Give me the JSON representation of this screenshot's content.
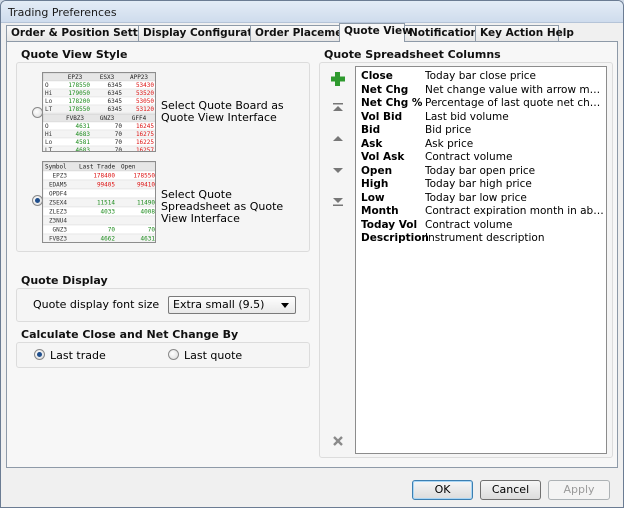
{
  "window": {
    "title": "Trading Preferences"
  },
  "tabs": [
    {
      "label": "Order & Position Settings"
    },
    {
      "label": "Display Configuration"
    },
    {
      "label": "Order Placement"
    },
    {
      "label": "Quote View"
    },
    {
      "label": "Notifications"
    },
    {
      "label": "Key Action Help"
    }
  ],
  "quote_view_style": {
    "title": "Quote View Style",
    "board_option": "Select Quote Board as Quote View Interface",
    "spreadsheet_option": "Select Quote Spreadsheet as Quote View Interface",
    "selected": "spreadsheet",
    "board_preview": {
      "top_headers": [
        "EPZ3",
        "ESX3",
        "APP23"
      ],
      "top_rows": [
        {
          "label": "O",
          "v": [
            "178550",
            "6345",
            "53430"
          ]
        },
        {
          "label": "Hi",
          "v": [
            "179050",
            "6345",
            "53520"
          ]
        },
        {
          "label": "Lo",
          "v": [
            "178200",
            "6345",
            "53050"
          ]
        },
        {
          "label": "LT",
          "v": [
            "178550",
            "6345",
            "53120"
          ]
        }
      ],
      "bottom_headers": [
        "FVBZ3",
        "GNZ3",
        "GFF4"
      ],
      "bottom_rows": [
        {
          "label": "O",
          "v": [
            "4631",
            "70",
            "16245"
          ]
        },
        {
          "label": "Hi",
          "v": [
            "4683",
            "70",
            "16275"
          ]
        },
        {
          "label": "Lo",
          "v": [
            "4581",
            "70",
            "16225"
          ]
        },
        {
          "label": "LT",
          "v": [
            "4683",
            "70",
            "16257"
          ]
        }
      ]
    },
    "sheet_preview": {
      "headers": [
        "Symbol",
        "Last Trade",
        "Open"
      ],
      "rows": [
        {
          "s": "EPZ3",
          "lt": "178400",
          "o": "178550",
          "c": "red"
        },
        {
          "s": "EDAM5",
          "lt": "99405",
          "o": "99410",
          "c": "red"
        },
        {
          "s": "OPDF4",
          "lt": "",
          "o": "",
          "c": ""
        },
        {
          "s": "ZSEX4",
          "lt": "11514",
          "o": "11490",
          "c": "green"
        },
        {
          "s": "ZLEZ3",
          "lt": "4033",
          "o": "4008",
          "c": "green"
        },
        {
          "s": "Z3NU4",
          "lt": "",
          "o": "",
          "c": ""
        },
        {
          "s": "GNZ3",
          "lt": "70",
          "o": "70",
          "c": "green"
        },
        {
          "s": "FVBZ3",
          "lt": "4662",
          "o": "4631",
          "c": "green"
        }
      ]
    }
  },
  "quote_display": {
    "title": "Quote Display",
    "font_size_label": "Quote display font size",
    "font_size_value": "Extra small (9.5)"
  },
  "calculate": {
    "title": "Calculate Close and Net Change By",
    "last_trade": "Last trade",
    "last_quote": "Last quote",
    "selected": "last_trade"
  },
  "columns": {
    "title": "Quote Spreadsheet Columns",
    "items": [
      {
        "name": "Close",
        "desc": "Today bar close price"
      },
      {
        "name": "Net Chg",
        "desc": "Net change value with arrow mark"
      },
      {
        "name": "Net Chg %",
        "desc": "Percentage of last quote net change to ..."
      },
      {
        "name": "Vol Bid",
        "desc": "Last bid volume"
      },
      {
        "name": "Bid",
        "desc": "Bid price"
      },
      {
        "name": "Ask",
        "desc": "Ask price"
      },
      {
        "name": "Vol Ask",
        "desc": "Contract volume"
      },
      {
        "name": "Open",
        "desc": "Today bar open price"
      },
      {
        "name": "High",
        "desc": "Today bar high price"
      },
      {
        "name": "Low",
        "desc": "Today bar low price"
      },
      {
        "name": "Month",
        "desc": "Contract expiration month in abbreviate..."
      },
      {
        "name": "Today Vol",
        "desc": "Contract volume"
      },
      {
        "name": "Description",
        "desc": "Instrument description"
      }
    ]
  },
  "buttons": {
    "ok": "OK",
    "cancel": "Cancel",
    "apply": "Apply"
  },
  "colors": {
    "add": "#2e9a2e",
    "remove": "#8a8a8a",
    "red": "#d11",
    "green": "#1a8a1a"
  },
  "icons": [
    "add-icon",
    "move-top-icon",
    "move-up-icon",
    "move-down-icon",
    "move-bottom-icon",
    "remove-icon"
  ]
}
